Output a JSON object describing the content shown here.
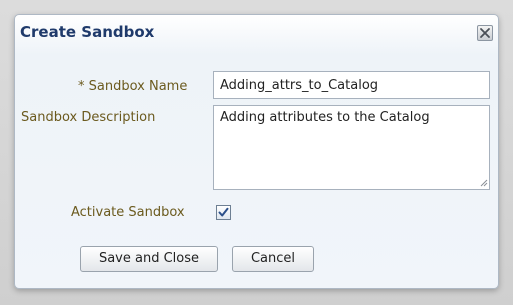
{
  "dialog": {
    "title": "Create Sandbox",
    "close_icon": "close-icon"
  },
  "form": {
    "name": {
      "required_marker": "*",
      "label": "Sandbox Name",
      "value": "Adding_attrs_to_Catalog"
    },
    "description": {
      "label": "Sandbox Description",
      "value": "Adding attributes to the Catalog"
    },
    "activate": {
      "label": "Activate Sandbox",
      "checked": true
    }
  },
  "buttons": {
    "save_close": "Save and Close",
    "cancel": "Cancel"
  },
  "colors": {
    "title": "#1f3a6b",
    "label": "#6b5a1e",
    "checkmark": "#2b4f8a"
  }
}
